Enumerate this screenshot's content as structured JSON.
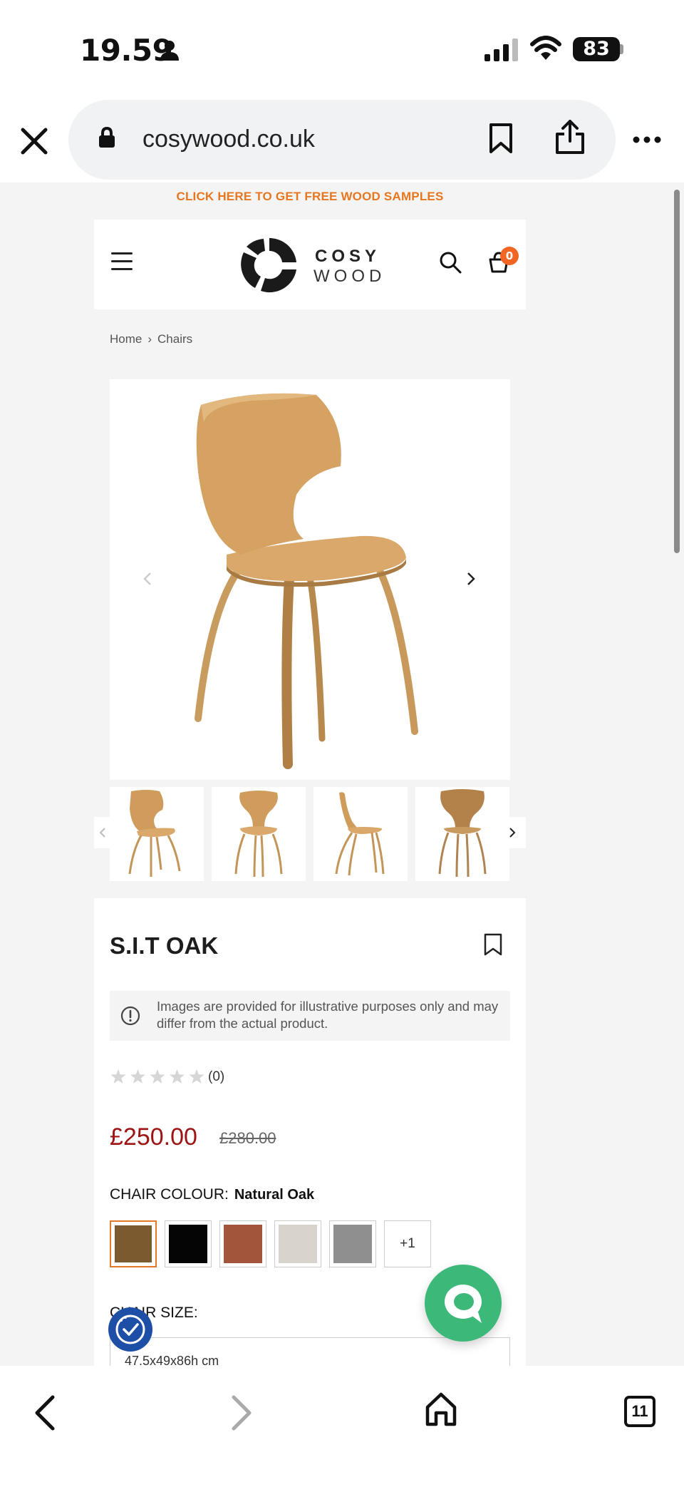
{
  "status_bar": {
    "time": "19.59",
    "battery": "83"
  },
  "browser": {
    "url": "cosywood.co.uk",
    "tab_count": "11"
  },
  "site": {
    "promo_banner": "CLICK HERE TO GET FREE WOOD SAMPLES",
    "logo_line1": "COSY",
    "logo_line2": "WOOD",
    "cart_count": "0"
  },
  "breadcrumb": {
    "items": [
      "Home",
      "Chairs"
    ],
    "separator": "›"
  },
  "product": {
    "title": "S.I.T OAK",
    "disclaimer": "Images are provided for illustrative purposes only and may differ from the actual product.",
    "rating": 0,
    "rating_max": 5,
    "review_count": "(0)",
    "price": "£250.00",
    "old_price": "£280.00",
    "colour_label": "CHAIR COLOUR:",
    "colour_selected": "Natural Oak",
    "swatches": [
      {
        "name": "oak",
        "color": "#7a5a2e",
        "selected": true
      },
      {
        "name": "black",
        "color": "#050505",
        "selected": false
      },
      {
        "name": "rust",
        "color": "#a2553a",
        "selected": false
      },
      {
        "name": "light-grey",
        "color": "#d8d4cd",
        "selected": false
      },
      {
        "name": "grey",
        "color": "#8f8f8f",
        "selected": false
      }
    ],
    "swatch_more": "+1",
    "size_label": "CHAIR SIZE:",
    "size_value": "47.5x49x86h cm"
  },
  "colors": {
    "accent_orange": "#e8761f",
    "price_red": "#9c1414",
    "chat_green": "#3cb878",
    "accessibility_blue": "#1e4fa6"
  }
}
